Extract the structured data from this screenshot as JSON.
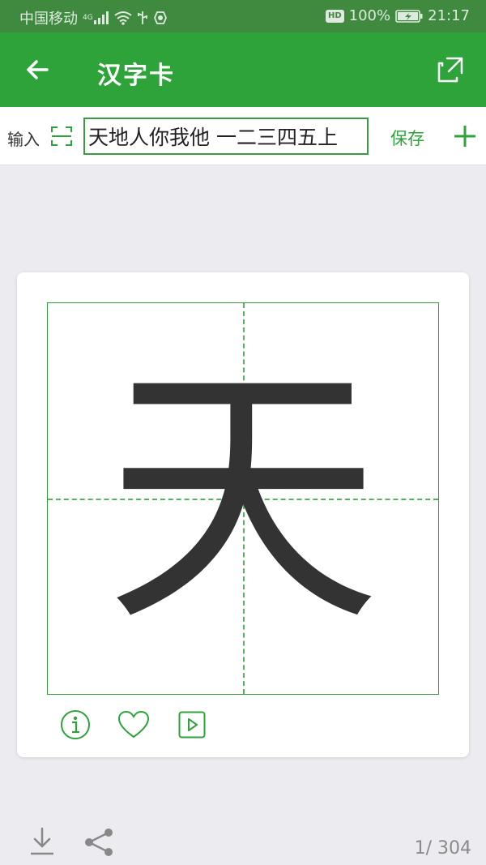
{
  "status_bar": {
    "carrier": "中国移动",
    "network": "4G",
    "battery": "100%",
    "hd": "HD",
    "time": "21:17"
  },
  "app_bar": {
    "title": "汉字卡",
    "back_icon": "arrow-left-icon",
    "action_icon": "open-external-icon"
  },
  "input_bar": {
    "label": "输入",
    "value": "天地人你我他 一二三四五上",
    "save_label": "保存",
    "scan_icon": "scan-icon",
    "add_icon": "plus-icon"
  },
  "card": {
    "character": "天",
    "actions": [
      "info-icon",
      "heart-icon",
      "play-icon"
    ]
  },
  "footer": {
    "pager": "1/ 304",
    "download_icon": "download-icon",
    "share_icon": "share-icon"
  },
  "colors": {
    "accent": "#2da33a",
    "status_bar": "#3f8a3f",
    "grid": "#3a9a44"
  }
}
